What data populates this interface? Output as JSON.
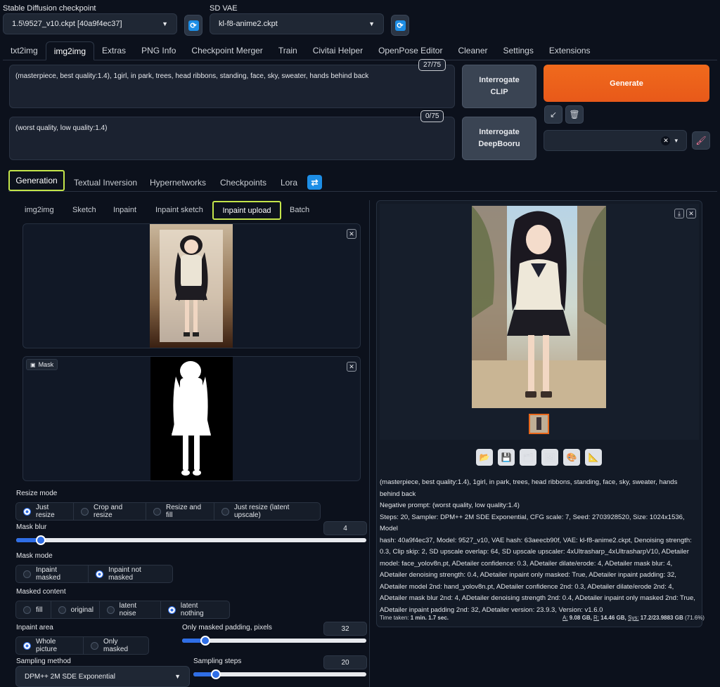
{
  "top": {
    "checkpoint_label": "Stable Diffusion checkpoint",
    "checkpoint_value": "1.5\\9527_v10.ckpt [40a9f4ec37]",
    "vae_label": "SD VAE",
    "vae_value": "kl-f8-anime2.ckpt"
  },
  "tabs": [
    "txt2img",
    "img2img",
    "Extras",
    "PNG Info",
    "Checkpoint Merger",
    "Train",
    "Civitai Helper",
    "OpenPose Editor",
    "Cleaner",
    "Settings",
    "Extensions"
  ],
  "prompt": {
    "positive": "(masterpiece, best quality:1.4), 1girl, in park, trees, head ribbons, standing, face, sky,  sweater, hands behind back",
    "positive_count": "27/75",
    "negative": "(worst quality, low quality:1.4)",
    "negative_count": "0/75"
  },
  "buttons": {
    "interrogate_clip": "Interrogate CLIP",
    "interrogate_deepbooru": "Interrogate DeepBooru",
    "generate": "Generate"
  },
  "extra_tabs": [
    "Generation",
    "Textual Inversion",
    "Hypernetworks",
    "Checkpoints",
    "Lora"
  ],
  "img_tabs": [
    "img2img",
    "Sketch",
    "Inpaint",
    "Inpaint sketch",
    "Inpaint upload",
    "Batch"
  ],
  "mask_label": "Mask",
  "resize": {
    "label": "Resize mode",
    "options": [
      "Just resize",
      "Crop and resize",
      "Resize and fill",
      "Just resize (latent upscale)"
    ],
    "selected": 0
  },
  "mask_blur": {
    "label": "Mask blur",
    "value": "4",
    "fraction": 0.07
  },
  "mask_mode": {
    "label": "Mask mode",
    "options": [
      "Inpaint masked",
      "Inpaint not masked"
    ],
    "selected": 1
  },
  "masked_content": {
    "label": "Masked content",
    "options": [
      "fill",
      "original",
      "latent noise",
      "latent nothing"
    ],
    "selected": 3
  },
  "inpaint_area": {
    "label": "Inpaint area",
    "options": [
      "Whole picture",
      "Only masked"
    ],
    "selected": 0
  },
  "padding": {
    "label": "Only masked padding, pixels",
    "value": "32",
    "fraction": 0.125
  },
  "sampling": {
    "method_label": "Sampling method",
    "method_value": "DPM++ 2M SDE Exponential",
    "steps_label": "Sampling steps",
    "steps_value": "20",
    "fraction": 0.13
  },
  "output": {
    "info_lines": [
      "(masterpiece, best quality:1.4), 1girl, in park, trees, head ribbons, standing, face, sky, sweater, hands",
      "behind back",
      "Negative prompt: (worst quality, low quality:1.4)",
      "Steps: 20, Sampler: DPM++ 2M SDE Exponential, CFG scale: 7, Seed: 2703928520, Size: 1024x1536, Model",
      "hash: 40a9f4ec37, Model: 9527_v10, VAE hash: 63aeecb90f, VAE: kl-f8-anime2.ckpt, Denoising strength:",
      "0.3, Clip skip: 2, SD upscale overlap: 64, SD upscale upscaler: 4xUltrasharp_4xUltrasharpV10, ADetailer",
      "model: face_yolov8n.pt, ADetailer confidence: 0.3, ADetailer dilate/erode: 4, ADetailer mask blur: 4,",
      "ADetailer denoising strength: 0.4, ADetailer inpaint only masked: True, ADetailer inpaint padding: 32,",
      "ADetailer model 2nd: hand_yolov8n.pt, ADetailer confidence 2nd: 0.3, ADetailer dilate/erode 2nd: 4,",
      "ADetailer mask blur 2nd: 4, ADetailer denoising strength 2nd: 0.4, ADetailer inpaint only masked 2nd: True,",
      "ADetailer inpaint padding 2nd: 32, ADetailer version: 23.9.3, Version: v1.6.0"
    ],
    "time_label": "Time taken:",
    "time_value": "1 min. 1.7 sec.",
    "mem_a_label": "A:",
    "mem_a": "9.08 GB,",
    "mem_r_label": "R:",
    "mem_r": "14.46 GB,",
    "mem_sys_label": "Sys:",
    "mem_sys": "17.2/23.9883 GB",
    "mem_pct": "(71.6%)"
  }
}
